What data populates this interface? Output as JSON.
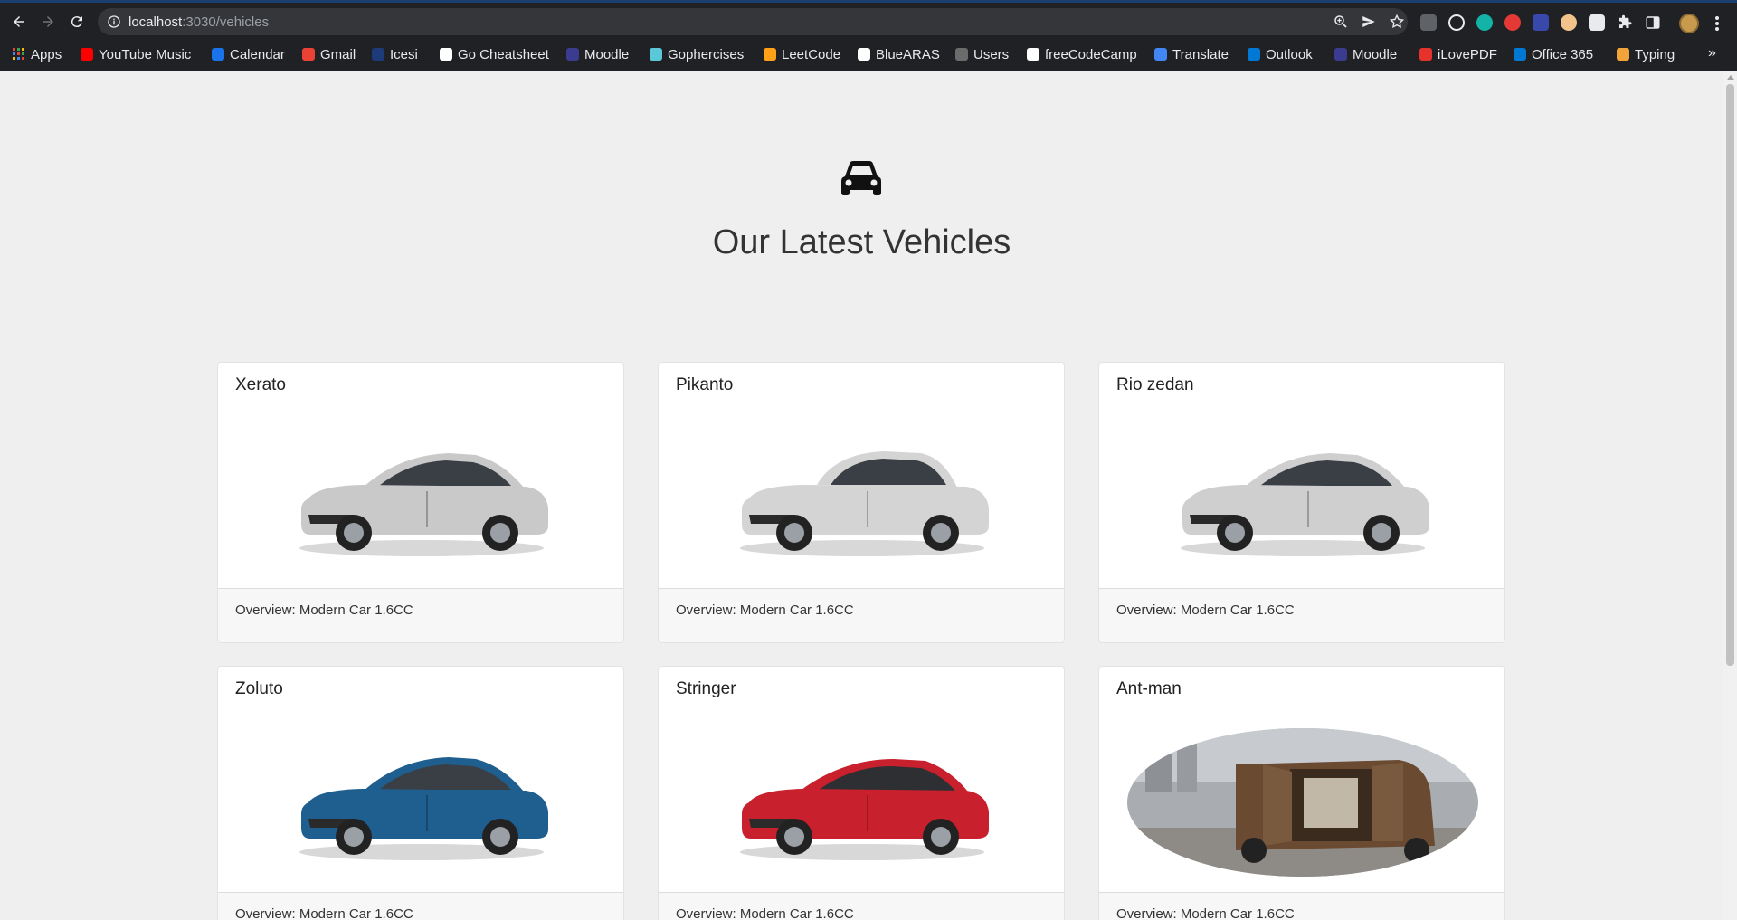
{
  "browser": {
    "url_host": "localhost",
    "url_path": ":3030/vehicles",
    "bookmarks": [
      {
        "label": "Apps",
        "color": "#4285f4"
      },
      {
        "label": "YouTube Music",
        "color": "#ff0000"
      },
      {
        "label": "Calendar",
        "color": "#1a73e8"
      },
      {
        "label": "Gmail",
        "color": "#ea4335"
      },
      {
        "label": "Icesi",
        "color": "#1d3a7a"
      },
      {
        "label": "Go Cheatsheet",
        "color": "#ffffff"
      },
      {
        "label": "Moodle",
        "color": "#3b3b8f"
      },
      {
        "label": "Gophercises",
        "color": "#5ac8d8"
      },
      {
        "label": "LeetCode",
        "color": "#ffa116"
      },
      {
        "label": "BlueARAS",
        "color": "#ffffff"
      },
      {
        "label": "Users",
        "color": "#6b6b6b"
      },
      {
        "label": "freeCodeCamp",
        "color": "#ffffff"
      },
      {
        "label": "Translate",
        "color": "#4285f4"
      },
      {
        "label": "Outlook",
        "color": "#0078d4"
      },
      {
        "label": "Moodle",
        "color": "#3b3b8f"
      },
      {
        "label": "iLovePDF",
        "color": "#e5322d"
      },
      {
        "label": "Office 365",
        "color": "#0078d4"
      },
      {
        "label": "Typing",
        "color": "#f2a33a"
      }
    ],
    "more_label": "»"
  },
  "page": {
    "title": "Our Latest Vehicles",
    "vehicles": [
      {
        "name": "Xerato",
        "overview": "Overview: Modern Car 1.6CC",
        "color": "#c9c9c9",
        "shape": "sedan"
      },
      {
        "name": "Pikanto",
        "overview": "Overview: Modern Car 1.6CC",
        "color": "#d4d4d4",
        "shape": "hatch"
      },
      {
        "name": "Rio zedan",
        "overview": "Overview: Modern Car 1.6CC",
        "color": "#cfcfcf",
        "shape": "sedan"
      },
      {
        "name": "Zoluto",
        "overview": "Overview: Modern Car 1.6CC",
        "color": "#1f5f8f",
        "shape": "sedan"
      },
      {
        "name": "Stringer",
        "overview": "Overview: Modern Car 1.6CC",
        "color": "#c8202c",
        "shape": "coupe"
      },
      {
        "name": "Ant-man",
        "overview": "Overview: Modern Car 1.6CC",
        "color": "#6b4a32",
        "shape": "van"
      }
    ]
  }
}
